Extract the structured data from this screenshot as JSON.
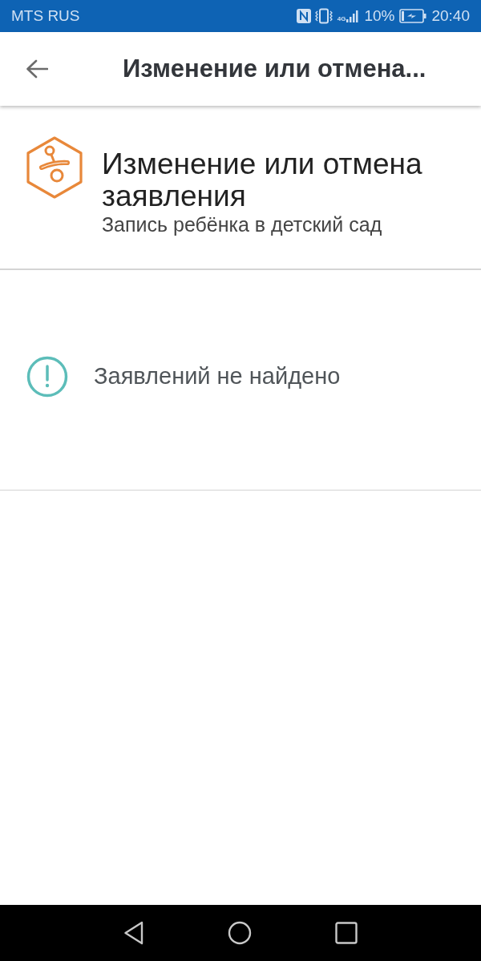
{
  "status_bar": {
    "carrier": "MTS RUS",
    "network_type": "4G",
    "battery": "10%",
    "charging": true,
    "time": "20:40"
  },
  "app_bar": {
    "title": "Изменение или отмена..."
  },
  "service_header": {
    "title": "Изменение или отмена заявления",
    "subtitle": "Запись ребёнка в детский сад"
  },
  "empty_state": {
    "message": "Заявлений не найдено"
  }
}
